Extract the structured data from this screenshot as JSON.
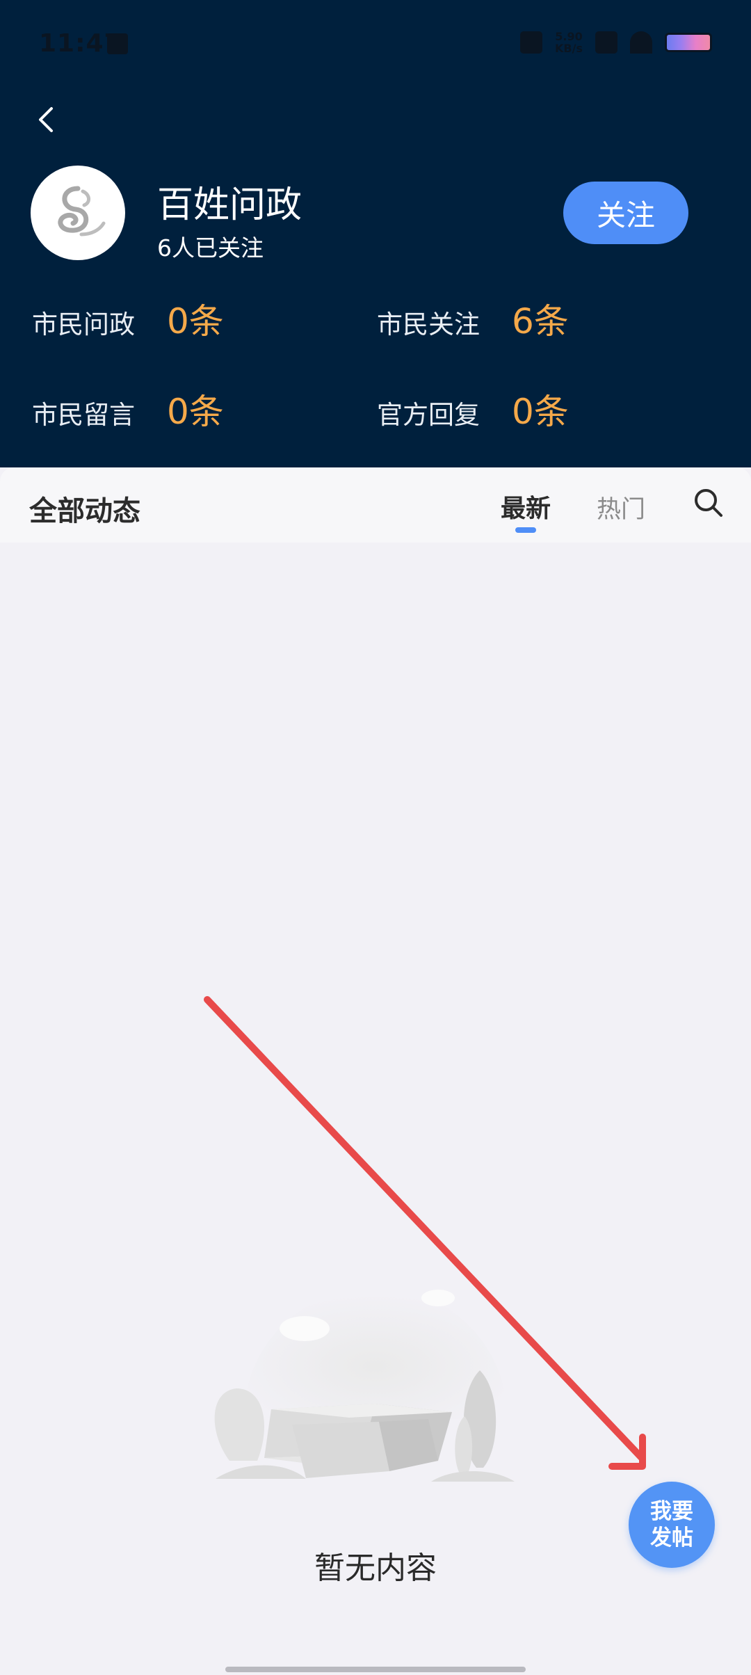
{
  "status_bar": {
    "time": "11:47",
    "net_speed_value": "5.90",
    "net_speed_unit": "KB/s"
  },
  "header": {
    "title": "百姓问政",
    "followers": "6人已关注",
    "follow_label": "关注",
    "stats": [
      {
        "label": "市民问政",
        "value": "0条"
      },
      {
        "label": "市民关注",
        "value": "6条"
      },
      {
        "label": "市民留言",
        "value": "0条"
      },
      {
        "label": "官方回复",
        "value": "0条"
      }
    ]
  },
  "tabs": {
    "section_title": "全部动态",
    "latest": "最新",
    "hot": "热门"
  },
  "empty_state": {
    "text": "暂无内容"
  },
  "fab": {
    "label_line1": "我要",
    "label_line2": "发帖"
  },
  "colors": {
    "header_bg": "#00203d",
    "accent": "#4f8ef7",
    "stat_value": "#f5a94a",
    "annotation_arrow": "#e84a4a"
  }
}
